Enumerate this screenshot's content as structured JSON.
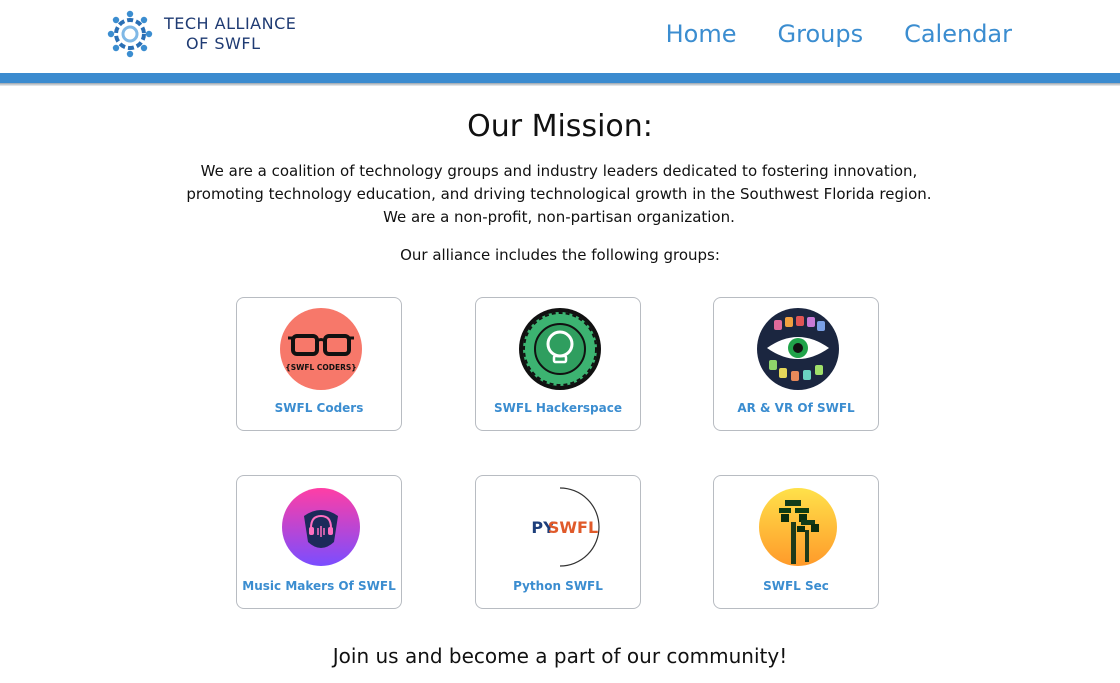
{
  "header": {
    "logo_line1": "TECH ALLIANCE",
    "logo_line2": "OF SWFL",
    "nav": [
      "Home",
      "Groups",
      "Calendar"
    ]
  },
  "main": {
    "title": "Our Mission:",
    "mission_text": "We are a coalition of technology groups and industry leaders dedicated to fostering innovation, promoting technology education, and driving technological growth in the Southwest Florida region. We are a non-profit, non-partisan organization.",
    "groups_intro": "Our alliance includes the following groups:",
    "groups": [
      {
        "name": "SWFL Coders",
        "icon": "glasses-icon",
        "logo_text": "{SWFL CODERS}"
      },
      {
        "name": "SWFL Hackerspace",
        "icon": "lightbulb-gear-icon"
      },
      {
        "name": "AR & VR Of SWFL",
        "icon": "eye-icon"
      },
      {
        "name": "Music Makers Of SWFL",
        "icon": "headphones-pick-icon"
      },
      {
        "name": "Python SWFL",
        "icon": "pyswfl-logo-icon",
        "logo_text_a": "PY",
        "logo_text_b": "SWFL"
      },
      {
        "name": "SWFL Sec",
        "icon": "palm-trees-icon"
      }
    ],
    "cta": "Join us and become a part of our community!"
  },
  "colors": {
    "accent": "#3b8dd0",
    "bar": "#3b8bcf",
    "logo_text": "#1f3b73"
  }
}
